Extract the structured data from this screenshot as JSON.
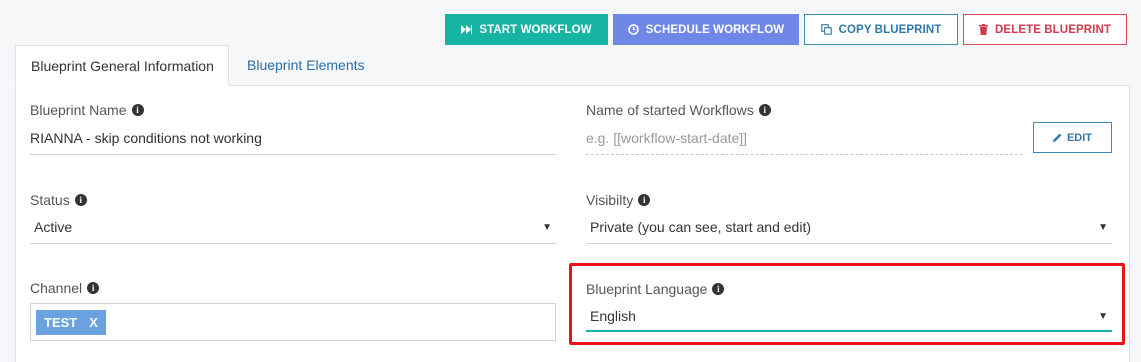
{
  "toolbar": {
    "start_label": "START WORKFLOW",
    "schedule_label": "SCHEDULE WORKFLOW",
    "copy_label": "COPY BLUEPRINT",
    "delete_label": "DELETE BLUEPRINT"
  },
  "tabs": [
    {
      "label": "Blueprint General Information",
      "active": true
    },
    {
      "label": "Blueprint Elements",
      "active": false
    }
  ],
  "form": {
    "blueprint_name": {
      "label": "Blueprint Name",
      "value": "RIANNA - skip conditions not working"
    },
    "workflow_name": {
      "label": "Name of started Workflows",
      "placeholder": "e.g. [[workflow-start-date]]",
      "edit_label": "EDIT"
    },
    "status": {
      "label": "Status",
      "value": "Active"
    },
    "visibility": {
      "label": "Visibilty",
      "value": "Private (you can see, start and edit)"
    },
    "channel": {
      "label": "Channel",
      "tags": [
        {
          "label": "TEST",
          "remove": "X"
        }
      ]
    },
    "language": {
      "label": "Blueprint Language",
      "value": "English"
    }
  },
  "colors": {
    "accent_teal": "#17b3a3",
    "accent_blue": "#6f87e6",
    "danger": "#d03a4c",
    "highlight": "#e8141b"
  }
}
